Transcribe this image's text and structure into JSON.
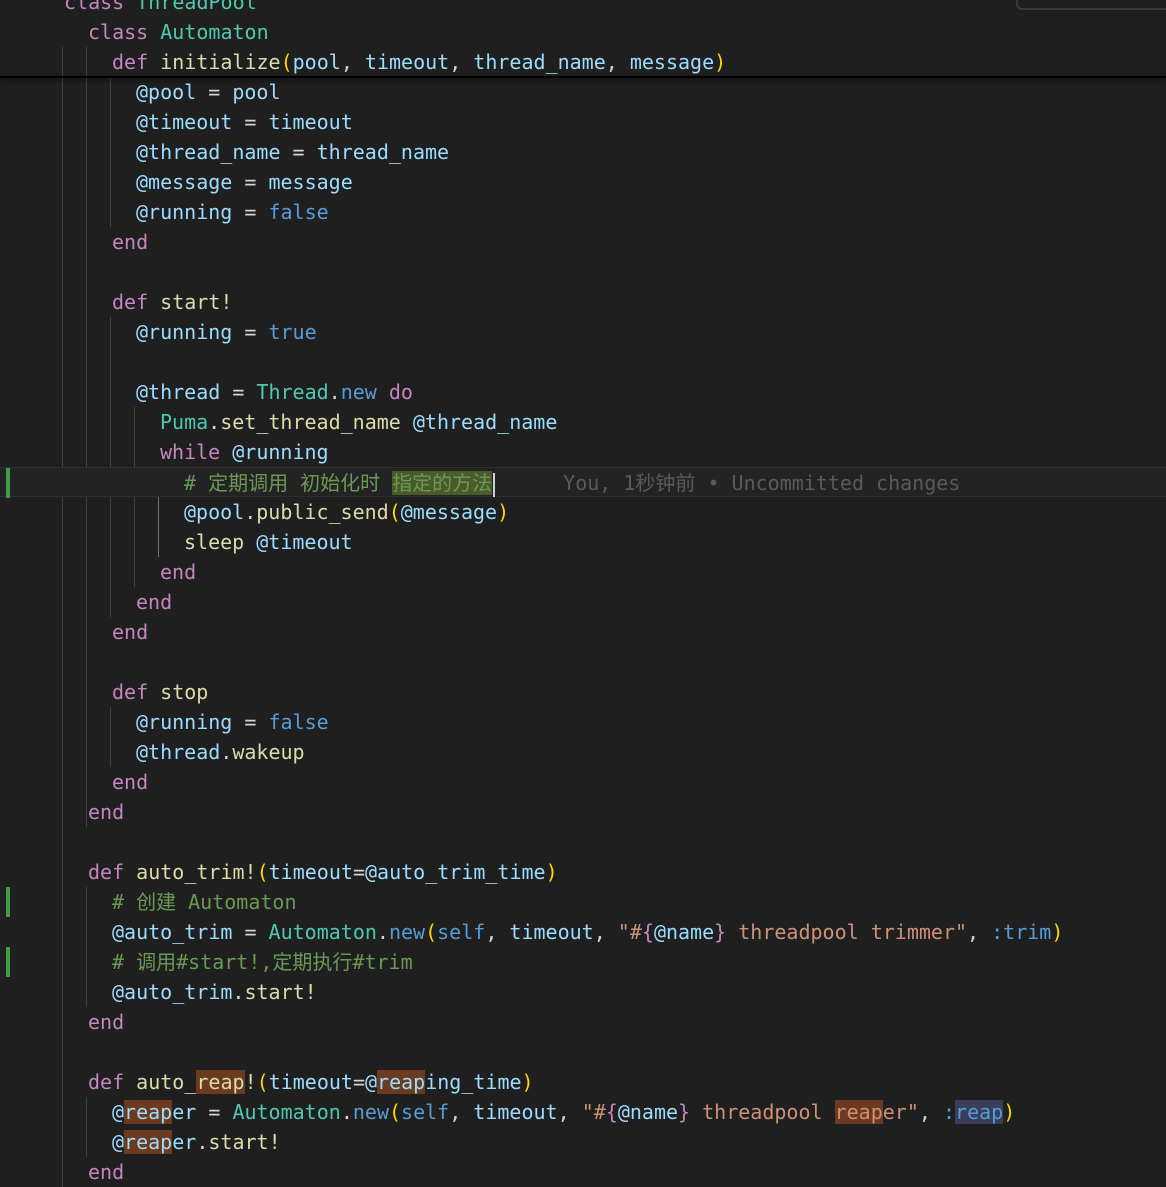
{
  "colors": {
    "background": "#1f1f1f",
    "keyword": "#c586c0",
    "method": "#dcdcaa",
    "variable": "#9cdcfe",
    "constant": "#4ec9b0",
    "string": "#ce9178",
    "comment": "#6a9955",
    "literal": "#569cd6",
    "bracket": "#ffd700",
    "default": "#d4d4d4",
    "git_added": "#3f9c3f",
    "blame": "#5a5a5a"
  },
  "editor": {
    "blame_annotation": "You, 1秒钟前 • Uncommitted changes",
    "lines": [
      {
        "indent": 2,
        "tokens": [
          {
            "t": "class ",
            "c": "keyword"
          },
          {
            "t": "ThreadPool",
            "c": "constant"
          }
        ]
      },
      {
        "indent": 3,
        "tokens": [
          {
            "t": "class ",
            "c": "keyword"
          },
          {
            "t": "Automaton",
            "c": "constant"
          }
        ]
      },
      {
        "indent": 4,
        "tokens": [
          {
            "t": "def ",
            "c": "keyword"
          },
          {
            "t": "initialize",
            "c": "method"
          },
          {
            "t": "(",
            "c": "bracket"
          },
          {
            "t": "pool",
            "c": "variable"
          },
          {
            "t": ", ",
            "c": "default"
          },
          {
            "t": "timeout",
            "c": "variable"
          },
          {
            "t": ", ",
            "c": "default"
          },
          {
            "t": "thread_name",
            "c": "variable"
          },
          {
            "t": ", ",
            "c": "default"
          },
          {
            "t": "message",
            "c": "variable"
          },
          {
            "t": ")",
            "c": "bracket"
          }
        ]
      },
      {
        "indent": 5,
        "tokens": [
          {
            "t": "@pool",
            "c": "variable"
          },
          {
            "t": " = ",
            "c": "default"
          },
          {
            "t": "pool",
            "c": "variable"
          }
        ]
      },
      {
        "indent": 5,
        "tokens": [
          {
            "t": "@timeout",
            "c": "variable"
          },
          {
            "t": " = ",
            "c": "default"
          },
          {
            "t": "timeout",
            "c": "variable"
          }
        ]
      },
      {
        "indent": 5,
        "tokens": [
          {
            "t": "@thread_name",
            "c": "variable"
          },
          {
            "t": " = ",
            "c": "default"
          },
          {
            "t": "thread_name",
            "c": "variable"
          }
        ]
      },
      {
        "indent": 5,
        "tokens": [
          {
            "t": "@message",
            "c": "variable"
          },
          {
            "t": " = ",
            "c": "default"
          },
          {
            "t": "message",
            "c": "variable"
          }
        ]
      },
      {
        "indent": 5,
        "tokens": [
          {
            "t": "@running",
            "c": "variable"
          },
          {
            "t": " = ",
            "c": "default"
          },
          {
            "t": "false",
            "c": "literal"
          }
        ]
      },
      {
        "indent": 4,
        "tokens": [
          {
            "t": "end",
            "c": "keyword"
          }
        ]
      },
      {
        "indent": 0,
        "tokens": []
      },
      {
        "indent": 4,
        "tokens": [
          {
            "t": "def ",
            "c": "keyword"
          },
          {
            "t": "start!",
            "c": "method"
          }
        ]
      },
      {
        "indent": 5,
        "tokens": [
          {
            "t": "@running",
            "c": "variable"
          },
          {
            "t": " = ",
            "c": "default"
          },
          {
            "t": "true",
            "c": "literal"
          }
        ]
      },
      {
        "indent": 0,
        "tokens": []
      },
      {
        "indent": 5,
        "tokens": [
          {
            "t": "@thread",
            "c": "variable"
          },
          {
            "t": " = ",
            "c": "default"
          },
          {
            "t": "Thread",
            "c": "constant"
          },
          {
            "t": ".",
            "c": "default"
          },
          {
            "t": "new",
            "c": "literal"
          },
          {
            "t": " do",
            "c": "keyword"
          }
        ]
      },
      {
        "indent": 6,
        "tokens": [
          {
            "t": "Puma",
            "c": "constant"
          },
          {
            "t": ".",
            "c": "default"
          },
          {
            "t": "set_thread_name",
            "c": "method"
          },
          {
            "t": " ",
            "c": "default"
          },
          {
            "t": "@thread_name",
            "c": "variable"
          }
        ]
      },
      {
        "indent": 6,
        "tokens": [
          {
            "t": "while ",
            "c": "keyword"
          },
          {
            "t": "@running",
            "c": "variable"
          }
        ]
      },
      {
        "indent": 7,
        "current": true,
        "blame": true,
        "git": true,
        "tokens": [
          {
            "t": "# 定期调用 初始化时 ",
            "c": "comment"
          },
          {
            "t": "指定的方法",
            "c": "comment",
            "hl": "sel-word"
          }
        ]
      },
      {
        "indent": 7,
        "tokens": [
          {
            "t": "@pool",
            "c": "variable"
          },
          {
            "t": ".",
            "c": "default"
          },
          {
            "t": "public_send",
            "c": "method"
          },
          {
            "t": "(",
            "c": "bracket"
          },
          {
            "t": "@message",
            "c": "variable"
          },
          {
            "t": ")",
            "c": "bracket"
          }
        ]
      },
      {
        "indent": 7,
        "tokens": [
          {
            "t": "sleep ",
            "c": "method"
          },
          {
            "t": "@timeout",
            "c": "variable"
          }
        ]
      },
      {
        "indent": 6,
        "tokens": [
          {
            "t": "end",
            "c": "keyword"
          }
        ]
      },
      {
        "indent": 5,
        "tokens": [
          {
            "t": "end",
            "c": "keyword"
          }
        ]
      },
      {
        "indent": 4,
        "tokens": [
          {
            "t": "end",
            "c": "keyword"
          }
        ]
      },
      {
        "indent": 0,
        "tokens": []
      },
      {
        "indent": 4,
        "tokens": [
          {
            "t": "def ",
            "c": "keyword"
          },
          {
            "t": "stop",
            "c": "method"
          }
        ]
      },
      {
        "indent": 5,
        "tokens": [
          {
            "t": "@running",
            "c": "variable"
          },
          {
            "t": " = ",
            "c": "default"
          },
          {
            "t": "false",
            "c": "literal"
          }
        ]
      },
      {
        "indent": 5,
        "tokens": [
          {
            "t": "@thread",
            "c": "variable"
          },
          {
            "t": ".",
            "c": "default"
          },
          {
            "t": "wakeup",
            "c": "method"
          }
        ]
      },
      {
        "indent": 4,
        "tokens": [
          {
            "t": "end",
            "c": "keyword"
          }
        ]
      },
      {
        "indent": 3,
        "tokens": [
          {
            "t": "end",
            "c": "keyword"
          }
        ]
      },
      {
        "indent": 0,
        "tokens": []
      },
      {
        "indent": 3,
        "tokens": [
          {
            "t": "def ",
            "c": "keyword"
          },
          {
            "t": "auto_trim!",
            "c": "method"
          },
          {
            "t": "(",
            "c": "bracket"
          },
          {
            "t": "timeout",
            "c": "variable"
          },
          {
            "t": "=",
            "c": "default"
          },
          {
            "t": "@auto_trim_time",
            "c": "variable"
          },
          {
            "t": ")",
            "c": "bracket"
          }
        ]
      },
      {
        "indent": 4,
        "git": true,
        "tokens": [
          {
            "t": "# 创建 Automaton",
            "c": "comment"
          }
        ]
      },
      {
        "indent": 4,
        "tokens": [
          {
            "t": "@auto_trim",
            "c": "variable"
          },
          {
            "t": " = ",
            "c": "default"
          },
          {
            "t": "Automaton",
            "c": "constant"
          },
          {
            "t": ".",
            "c": "default"
          },
          {
            "t": "new",
            "c": "literal"
          },
          {
            "t": "(",
            "c": "bracket"
          },
          {
            "t": "self",
            "c": "literal"
          },
          {
            "t": ", ",
            "c": "default"
          },
          {
            "t": "timeout",
            "c": "variable"
          },
          {
            "t": ", ",
            "c": "default"
          },
          {
            "t": "\"#",
            "c": "string"
          },
          {
            "t": "{",
            "c": "keyword"
          },
          {
            "t": "@name",
            "c": "variable"
          },
          {
            "t": "}",
            "c": "keyword"
          },
          {
            "t": " threadpool trimmer\"",
            "c": "string"
          },
          {
            "t": ", ",
            "c": "default"
          },
          {
            "t": ":trim",
            "c": "literal"
          },
          {
            "t": ")",
            "c": "bracket"
          }
        ]
      },
      {
        "indent": 4,
        "git": true,
        "tokens": [
          {
            "t": "# 调用#start!,定期执行#trim",
            "c": "comment"
          }
        ]
      },
      {
        "indent": 4,
        "tokens": [
          {
            "t": "@auto_trim",
            "c": "variable"
          },
          {
            "t": ".",
            "c": "default"
          },
          {
            "t": "start!",
            "c": "method"
          }
        ]
      },
      {
        "indent": 3,
        "tokens": [
          {
            "t": "end",
            "c": "keyword"
          }
        ]
      },
      {
        "indent": 0,
        "tokens": []
      },
      {
        "indent": 3,
        "tokens": [
          {
            "t": "def ",
            "c": "keyword"
          },
          {
            "t": "auto_",
            "c": "method"
          },
          {
            "t": "reap",
            "c": "method",
            "hl": "find-hl"
          },
          {
            "t": "!",
            "c": "method"
          },
          {
            "t": "(",
            "c": "bracket"
          },
          {
            "t": "timeout",
            "c": "variable"
          },
          {
            "t": "=",
            "c": "default"
          },
          {
            "t": "@",
            "c": "variable"
          },
          {
            "t": "reap",
            "c": "variable",
            "hl": "find-hl"
          },
          {
            "t": "ing_time",
            "c": "variable"
          },
          {
            "t": ")",
            "c": "bracket"
          }
        ]
      },
      {
        "indent": 4,
        "tokens": [
          {
            "t": "@",
            "c": "variable"
          },
          {
            "t": "reap",
            "c": "variable",
            "hl": "find-hl"
          },
          {
            "t": "er",
            "c": "variable"
          },
          {
            "t": " = ",
            "c": "default"
          },
          {
            "t": "Automaton",
            "c": "constant"
          },
          {
            "t": ".",
            "c": "default"
          },
          {
            "t": "new",
            "c": "literal"
          },
          {
            "t": "(",
            "c": "bracket"
          },
          {
            "t": "self",
            "c": "literal"
          },
          {
            "t": ", ",
            "c": "default"
          },
          {
            "t": "timeout",
            "c": "variable"
          },
          {
            "t": ", ",
            "c": "default"
          },
          {
            "t": "\"#",
            "c": "string"
          },
          {
            "t": "{",
            "c": "keyword"
          },
          {
            "t": "@name",
            "c": "variable"
          },
          {
            "t": "}",
            "c": "keyword"
          },
          {
            "t": " threadpool ",
            "c": "string"
          },
          {
            "t": "reap",
            "c": "string",
            "hl": "find-hl"
          },
          {
            "t": "er\"",
            "c": "string"
          },
          {
            "t": ", ",
            "c": "default"
          },
          {
            "t": ":",
            "c": "literal"
          },
          {
            "t": "reap",
            "c": "literal",
            "hl": "sym-hl"
          },
          {
            "t": ")",
            "c": "bracket"
          }
        ]
      },
      {
        "indent": 4,
        "tokens": [
          {
            "t": "@",
            "c": "variable"
          },
          {
            "t": "reap",
            "c": "variable",
            "hl": "find-hl"
          },
          {
            "t": "er",
            "c": "variable"
          },
          {
            "t": ".",
            "c": "default"
          },
          {
            "t": "start!",
            "c": "method"
          }
        ]
      },
      {
        "indent": 3,
        "tokens": [
          {
            "t": "end",
            "c": "keyword"
          }
        ]
      }
    ]
  }
}
